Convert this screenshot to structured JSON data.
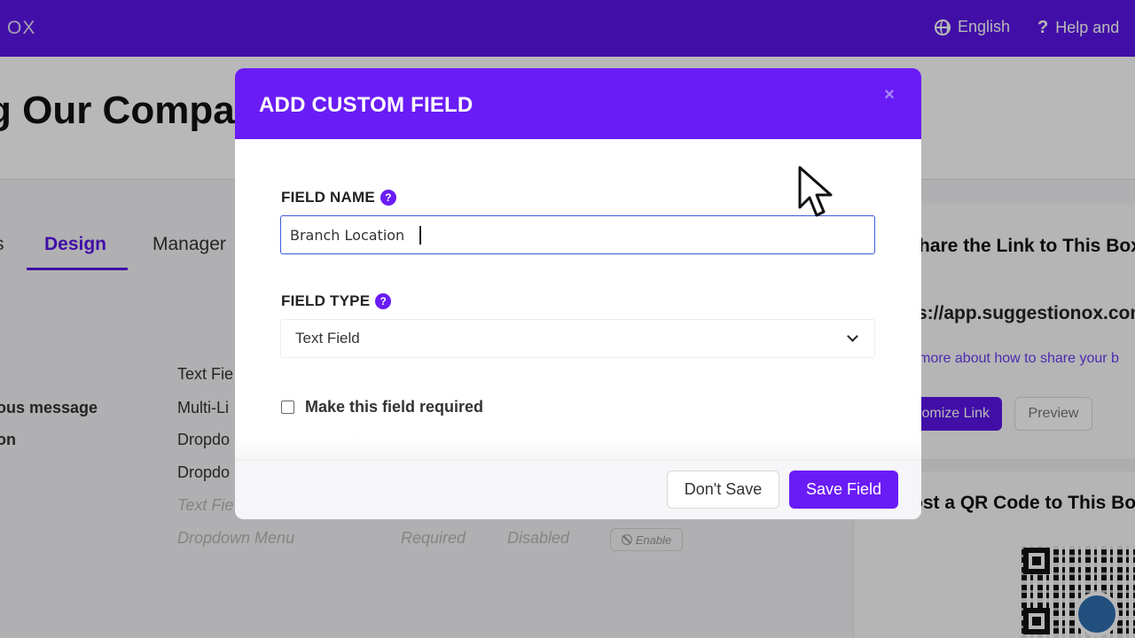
{
  "app": {
    "brand": "OX",
    "language": "English",
    "help": "Help and",
    "page_title": "g Our Compa"
  },
  "tabs": {
    "prev": "s",
    "design": "Design",
    "manage": "Manager"
  },
  "background_rows": {
    "left": [
      "ous message",
      "on"
    ],
    "types": [
      "Text Fie",
      "Multi-Li",
      "Dropdo",
      "Dropdo",
      "Text Fie",
      "Dropdown Menu"
    ],
    "required": "Required",
    "disabled": "Disabled",
    "enable": "Enable"
  },
  "right_panel": {
    "share_title": "hare the Link to This Box",
    "share_url": "s://app.suggestionox.com",
    "share_more": "more about how to share your b",
    "customize_button": "omize Link",
    "preview_button": "Preview",
    "qr_title": "ost a QR Code to This Bo"
  },
  "modal": {
    "title": "ADD CUSTOM FIELD",
    "close_glyph": "×",
    "field_name_label": "FIELD NAME",
    "field_name_value": "Branch Location",
    "field_type_label": "FIELD TYPE",
    "field_type_value": "Text Field",
    "required_label": "Make this field required",
    "required_checked": false,
    "dont_save_label": "Don't Save",
    "save_label": "Save Field",
    "help_glyph": "?"
  },
  "colors": {
    "brand": "#5b16e8",
    "modal_header": "#6a1cf6",
    "input_focus": "#3b5bdb"
  },
  "icons": [
    "globe-icon",
    "help-icon",
    "close-icon",
    "question-icon",
    "chevron-down-icon",
    "ban-icon",
    "qr-code",
    "mouse-cursor-icon"
  ]
}
